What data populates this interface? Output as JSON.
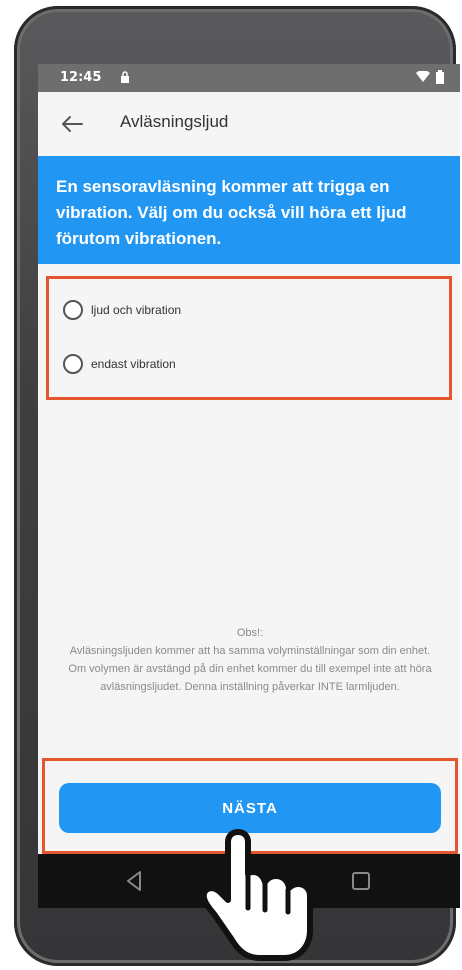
{
  "status_bar": {
    "time": "12:45",
    "icons": [
      "lock-icon",
      "wifi-icon",
      "battery-icon"
    ]
  },
  "app_bar": {
    "title": "Avläsningsljud",
    "back_icon": "arrow-left-icon"
  },
  "banner": {
    "text": "En sensoravläsning kommer att trigga en vibration. Välj om du också vill höra ett ljud förutom vibrationen."
  },
  "options": [
    {
      "label": "ljud och vibration"
    },
    {
      "label": "endast vibration"
    }
  ],
  "note": {
    "title": "Obs!:",
    "body": "Avläsningsljuden kommer att ha samma volyminställningar som din enhet. Om volymen är avstängd på din enhet kommer du till exempel inte att höra avläsningsljudet. Denna inställning påverkar INTE larmljuden."
  },
  "next_button": {
    "label": "NÄSTA"
  },
  "colors": {
    "accent": "#2196f3",
    "highlight": "#e4572e"
  }
}
